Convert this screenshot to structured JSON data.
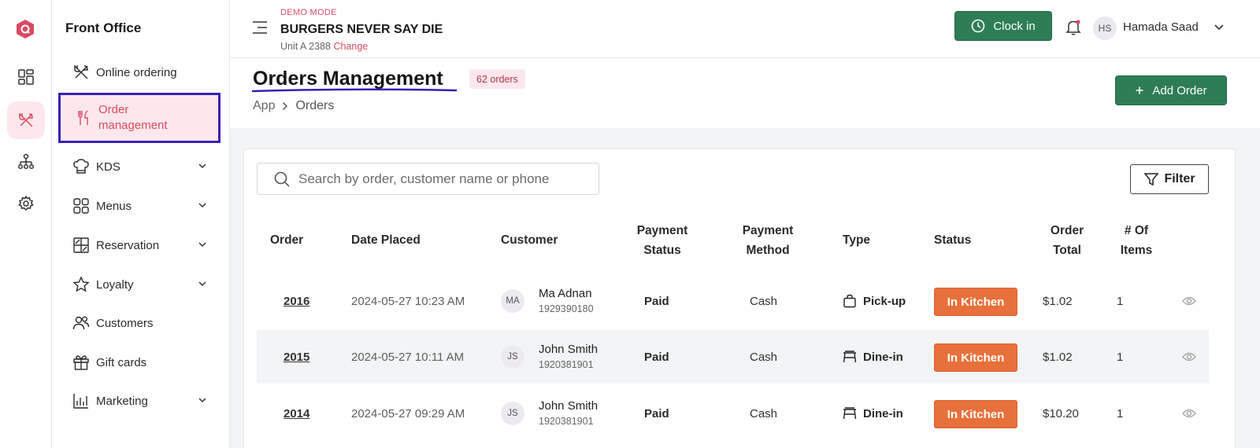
{
  "sidebar": {
    "title": "Front Office",
    "items": [
      {
        "label": "Online ordering"
      },
      {
        "label": "Order management"
      },
      {
        "label": "KDS"
      },
      {
        "label": "Menus"
      },
      {
        "label": "Reservation"
      },
      {
        "label": "Loyalty"
      },
      {
        "label": "Customers"
      },
      {
        "label": "Gift cards"
      },
      {
        "label": "Marketing"
      }
    ]
  },
  "header": {
    "demo_mode": "DEMO MODE",
    "restaurant": "BURGERS NEVER SAY DIE",
    "unit": "Unit A 2388",
    "change_link": "Change",
    "clock_in": "Clock in",
    "user_initials": "HS",
    "user_name": "Hamada Saad"
  },
  "page": {
    "title": "Orders Management",
    "order_count": "62 orders",
    "breadcrumb": [
      "App",
      "Orders"
    ],
    "add_order": "Add Order",
    "search_placeholder": "Search by order, customer name or phone",
    "filter_label": "Filter"
  },
  "table": {
    "columns": {
      "order": "Order",
      "date": "Date Placed",
      "customer": "Customer",
      "payment_status": "Payment Status",
      "payment_method": "Payment Method",
      "type": "Type",
      "status": "Status",
      "total": "Order Total",
      "items": "# Of Items"
    },
    "rows": [
      {
        "order": "2016",
        "date": "2024-05-27 10:23 AM",
        "initials": "MA",
        "name": "Ma Adnan",
        "phone": "1929390180",
        "payment_status": "Paid",
        "payment_method": "Cash",
        "type": "Pick-up",
        "type_icon": "bag-icon",
        "status": "In Kitchen",
        "total": "$1.02",
        "items": "1"
      },
      {
        "order": "2015",
        "date": "2024-05-27 10:11 AM",
        "initials": "JS",
        "name": "John Smith",
        "phone": "1920381901",
        "payment_status": "Paid",
        "payment_method": "Cash",
        "type": "Dine-in",
        "type_icon": "table-icon",
        "status": "In Kitchen",
        "total": "$1.02",
        "items": "1"
      },
      {
        "order": "2014",
        "date": "2024-05-27 09:29 AM",
        "initials": "JS",
        "name": "John Smith",
        "phone": "1920381901",
        "payment_status": "Paid",
        "payment_method": "Cash",
        "type": "Dine-in",
        "type_icon": "table-icon",
        "status": "In Kitchen",
        "total": "$10.20",
        "items": "1"
      }
    ]
  },
  "colors": {
    "brand": "#d94a63",
    "primary_button": "#2e7d55",
    "status_in_kitchen": "#e8703a",
    "highlight_border": "#3a1fb5"
  }
}
